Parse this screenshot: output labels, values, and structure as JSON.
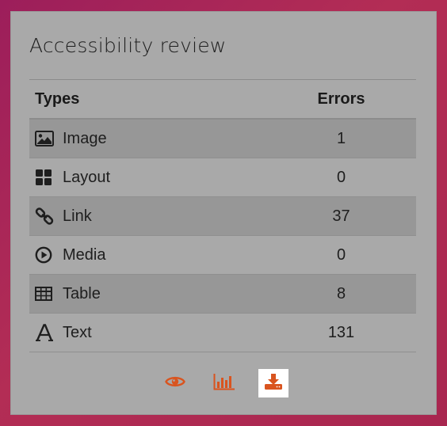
{
  "card": {
    "title": "Accessibility review"
  },
  "table": {
    "columns": [
      "Types",
      "Errors"
    ],
    "rows": [
      {
        "type": "Image",
        "errors": "1",
        "icon": "image-icon"
      },
      {
        "type": "Layout",
        "errors": "0",
        "icon": "layout-grid-icon"
      },
      {
        "type": "Link",
        "errors": "37",
        "icon": "link-icon"
      },
      {
        "type": "Media",
        "errors": "0",
        "icon": "play-circle-icon"
      },
      {
        "type": "Table",
        "errors": "8",
        "icon": "table-icon"
      },
      {
        "type": "Text",
        "errors": "131",
        "icon": "text-font-icon"
      }
    ]
  },
  "actions": [
    {
      "name": "view",
      "icon": "eye-icon",
      "active": false
    },
    {
      "name": "report",
      "icon": "bar-chart-icon",
      "active": false
    },
    {
      "name": "download",
      "icon": "download-icon",
      "active": true
    }
  ],
  "colors": {
    "accent": "#d9541f",
    "card_bg": "#a9a9a9",
    "stripe": "#979797"
  }
}
